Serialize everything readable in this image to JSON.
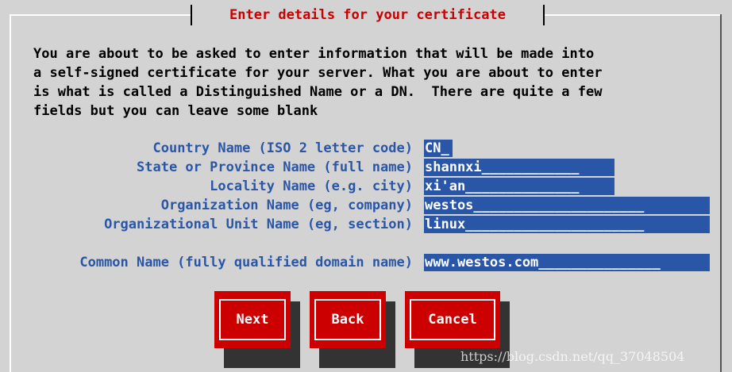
{
  "dialog": {
    "title": "Enter details for your certificate",
    "intro": "You are about to be asked to enter information that will be made into\na self-signed certificate for your server. What you are about to enter\nis what is called a Distinguished Name or a DN.  There are quite a few\nfields but you can leave some blank"
  },
  "fields": [
    {
      "label": "Country Name (ISO 2 letter code)",
      "value": "CN_"
    },
    {
      "label": "State or Province Name (full name)",
      "value": "shannxi____________"
    },
    {
      "label": "Locality Name (e.g. city)",
      "value": "xi'an______________"
    },
    {
      "label": "Organization Name (eg, company)",
      "value": "westos_____________________"
    },
    {
      "label": "Organizational Unit Name (eg, section)",
      "value": "linux______________________"
    },
    {
      "label": "Common Name (fully qualified domain name)",
      "value": "www.westos.com_______________"
    }
  ],
  "buttons": {
    "next": "Next",
    "back": "Back",
    "cancel": "Cancel"
  },
  "watermark": "https://blog.csdn.net/qq_37048504",
  "colors": {
    "background": "#d3d3d3",
    "title": "#cc0000",
    "label": "#2a56a8",
    "field_bg": "#2a56a8",
    "button": "#cc0000"
  }
}
